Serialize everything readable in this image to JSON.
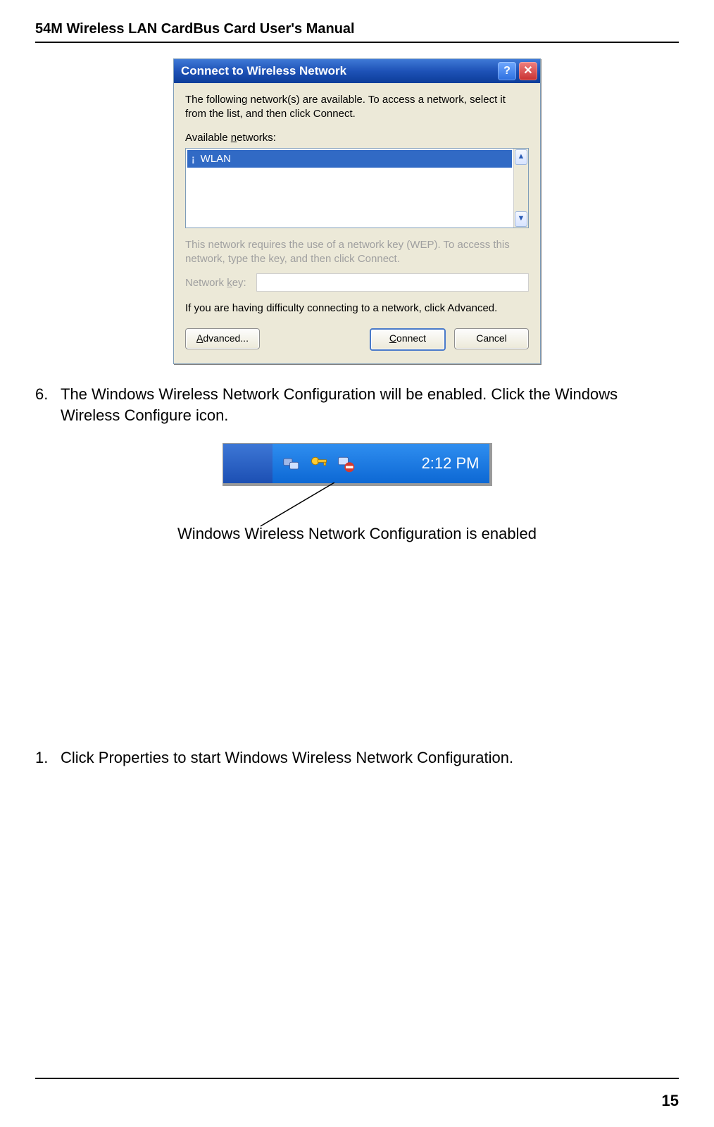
{
  "header": {
    "title": "54M Wireless LAN CardBus Card User's Manual"
  },
  "dialog": {
    "title": "Connect to Wireless Network",
    "intro": "The following network(s) are available. To access a network, select it from the list, and then click Connect.",
    "available_label": "Available networks:",
    "networks": [
      {
        "ssid": "WLAN"
      }
    ],
    "wep_note": "This network requires the use of a network key (WEP). To access this network, type the key, and then click Connect.",
    "key_label": "Network key:",
    "key_value": "",
    "difficulty": "If you are having difficulty connecting to a network, click Advanced.",
    "buttons": {
      "advanced": "Advanced...",
      "connect": "Connect",
      "cancel": "Cancel"
    }
  },
  "step6": {
    "num": "6.",
    "text": "The Windows Wireless Network Configuration will be enabled. Click the Windows Wireless Configure icon."
  },
  "taskbar": {
    "time": "2:12 PM",
    "icons": {
      "monitors": "network-monitors-icon",
      "keys": "security-keys-icon",
      "wifi": "wireless-disabled-icon"
    }
  },
  "caption": "Windows Wireless Network Configuration is enabled",
  "step1": {
    "num": "1.",
    "text": "Click Properties to start Windows Wireless Network Configuration."
  },
  "page_number": "15"
}
